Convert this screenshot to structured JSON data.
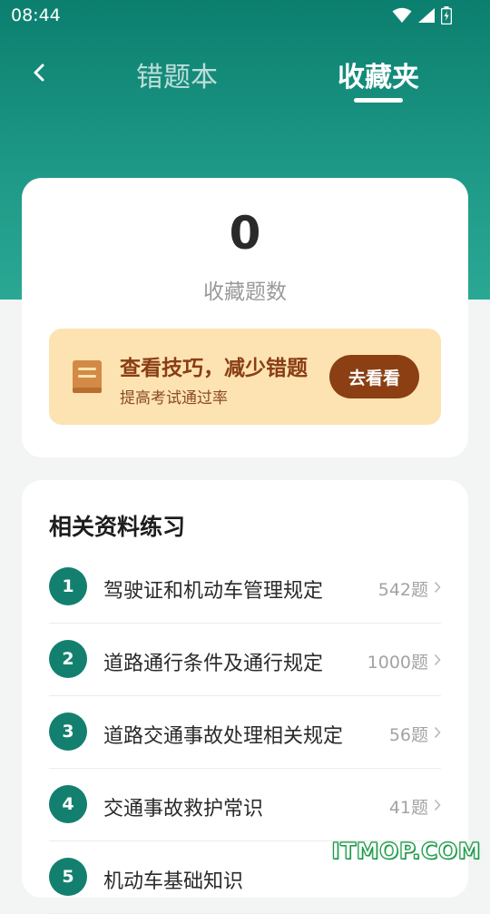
{
  "status_bar": {
    "time": "08:44"
  },
  "nav": {
    "tabs": [
      {
        "label": "错题本"
      },
      {
        "label": "收藏夹"
      }
    ],
    "active_tab": "收藏夹"
  },
  "stats": {
    "count": "0",
    "count_label": "收藏题数"
  },
  "tip": {
    "title": "查看技巧，减少错题",
    "subtitle": "提高考试通过率",
    "button_label": "去看看"
  },
  "practice": {
    "title": "相关资料练习",
    "items": [
      {
        "num": "1",
        "label": "驾驶证和机动车管理规定",
        "count": "542题"
      },
      {
        "num": "2",
        "label": "道路通行条件及通行规定",
        "count": "1000题"
      },
      {
        "num": "3",
        "label": "道路交通事故处理相关规定",
        "count": "56题"
      },
      {
        "num": "4",
        "label": "交通事故救护常识",
        "count": "41题"
      },
      {
        "num": "5",
        "label": "机动车基础知识",
        "count": ""
      }
    ]
  },
  "watermark": "ITMOP.COM",
  "colors": {
    "header_gradient_top": "#0c7f6f",
    "header_gradient_bottom": "#2aa894",
    "accent_green": "#13806f",
    "tip_background": "#fde3b2",
    "tip_button": "#8b3f13"
  }
}
